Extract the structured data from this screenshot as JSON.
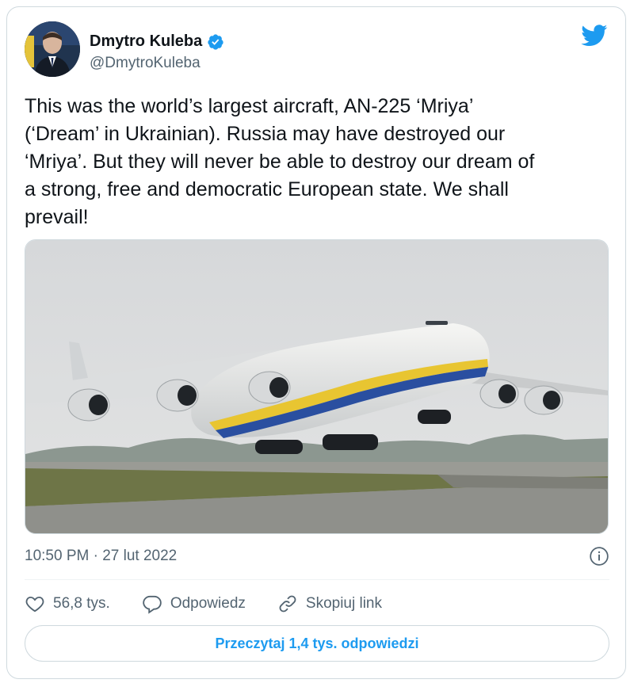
{
  "author": {
    "name": "Dmytro Kuleba",
    "handle": "@DmytroKuleba",
    "verified": true
  },
  "tweet": {
    "text": "This was the world’s largest aircraft, AN-225 ‘Mriya’\n(‘Dream’ in Ukrainian). Russia may have destroyed our\n‘Mriya’. But they will never be able to destroy our dream of\na strong, free and democratic European state. We shall\nprevail!",
    "timestamp": "10:50 PM · 27 lut 2022"
  },
  "media": {
    "subject": "AN-225 Mriya aircraft taking off from runway"
  },
  "actions": {
    "likes_count": "56,8 tys.",
    "reply_label": "Odpowiedz",
    "copy_link_label": "Skopiuj link"
  },
  "read_replies_label": "Przeczytaj 1,4 tys. odpowiedzi",
  "colors": {
    "accent": "#1d9bf0",
    "text_secondary": "#536471",
    "border": "#cfd9de"
  }
}
